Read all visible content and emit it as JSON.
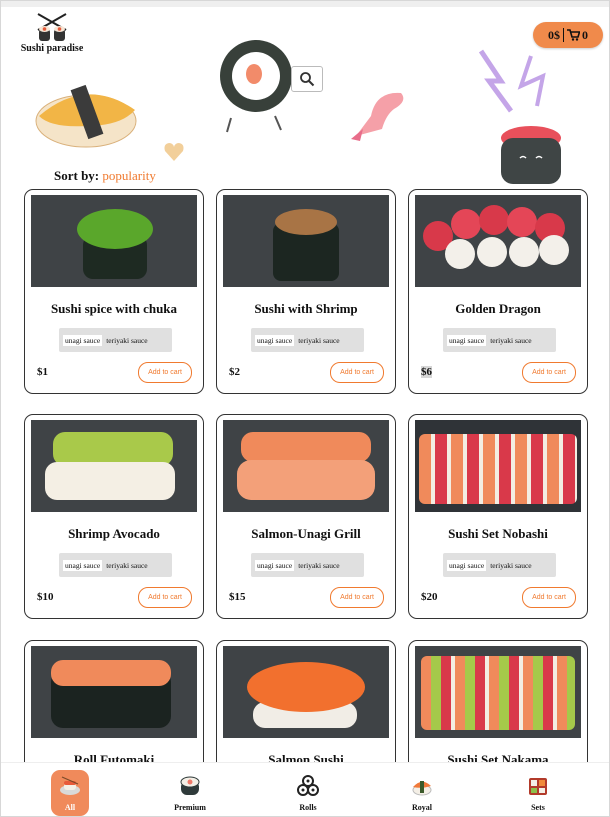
{
  "app": {
    "title": "Sushi paradise",
    "cart_amount": "0$",
    "cart_count": "0",
    "accent": "#f08a4b"
  },
  "sort": {
    "label": "Sort by:",
    "value": "popularity"
  },
  "products": [
    {
      "name": "Sushi spice with chuka",
      "price": "$1",
      "sauce1": "unagi sauce",
      "sauce2": "teriyaki sauce",
      "add_label": "Add to cart"
    },
    {
      "name": "Sushi with Shrimp",
      "price": "$2",
      "sauce1": "unagi sauce",
      "sauce2": "teriyaki sauce",
      "add_label": "Add to cart"
    },
    {
      "name": "Golden Dragon",
      "price": "$6",
      "sauce1": "unagi sauce",
      "sauce2": "teriyaki sauce",
      "add_label": "Add to cart"
    },
    {
      "name": "Shrimp Avocado",
      "price": "$10",
      "sauce1": "unagi sauce",
      "sauce2": "teriyaki sauce",
      "add_label": "Add to cart"
    },
    {
      "name": "Salmon-Unagi Grill",
      "price": "$15",
      "sauce1": "unagi sauce",
      "sauce2": "teriyaki sauce",
      "add_label": "Add to cart"
    },
    {
      "name": "Sushi Set Nobashi",
      "price": "$20",
      "sauce1": "unagi sauce",
      "sauce2": "teriyaki sauce",
      "add_label": "Add to cart"
    },
    {
      "name": "Roll Futomaki",
      "price": "",
      "sauce1": "",
      "sauce2": "",
      "add_label": ""
    },
    {
      "name": "Salmon Sushi",
      "price": "",
      "sauce1": "",
      "sauce2": "",
      "add_label": ""
    },
    {
      "name": "Sushi Set Nakama",
      "price": "",
      "sauce1": "",
      "sauce2": "",
      "add_label": ""
    }
  ],
  "nav": [
    {
      "label": "All",
      "icon": "sushi-plate-icon",
      "active": true
    },
    {
      "label": "Premium",
      "icon": "maki-roll-icon",
      "active": false
    },
    {
      "label": "Rolls",
      "icon": "rolls-stack-icon",
      "active": false
    },
    {
      "label": "Royal",
      "icon": "nigiri-icon",
      "active": false
    },
    {
      "label": "Sets",
      "icon": "bento-box-icon",
      "active": false
    }
  ]
}
